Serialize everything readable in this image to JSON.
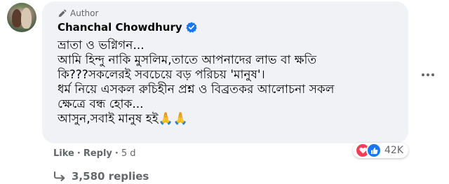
{
  "comment": {
    "author_badge": "Author",
    "author_name": "Chanchal Chowdhury",
    "text_lines": [
      "ভ্রাতা ও ভগ্নিগন...",
      "আমি হিন্দু নাকি মুসলিম,তাতে আপনাদের লাভ বা ক্ষতি",
      "কি???সকলেরই সবচেয়ে বড় পরিচয় 'মানুষ'।",
      "ধর্ম নিয়ে এসকল রুচিহীন প্রশ্ন ও বিব্রতকর আলোচনা সকল",
      "ক্ষেত্রে বন্ধ হোক...",
      "আসুন,সবাই মানুষ হই🙏🙏"
    ],
    "actions": {
      "like_label": "Like",
      "separator": "·",
      "reply_label": "Reply",
      "time": "5 d"
    },
    "reactions": {
      "count": "42K",
      "types": [
        "love",
        "like"
      ]
    },
    "replies_label": "3,580 replies"
  },
  "colors": {
    "bubble_bg": "#f0f2f5",
    "verified": "#1877f2",
    "love": "#f33e58",
    "like": "#1877f2",
    "secondary_text": "#65676b"
  },
  "icons": [
    "pencil-icon",
    "verified-icon",
    "more-options-icon",
    "love-reaction-icon",
    "like-reaction-icon",
    "reply-arrow-icon"
  ]
}
